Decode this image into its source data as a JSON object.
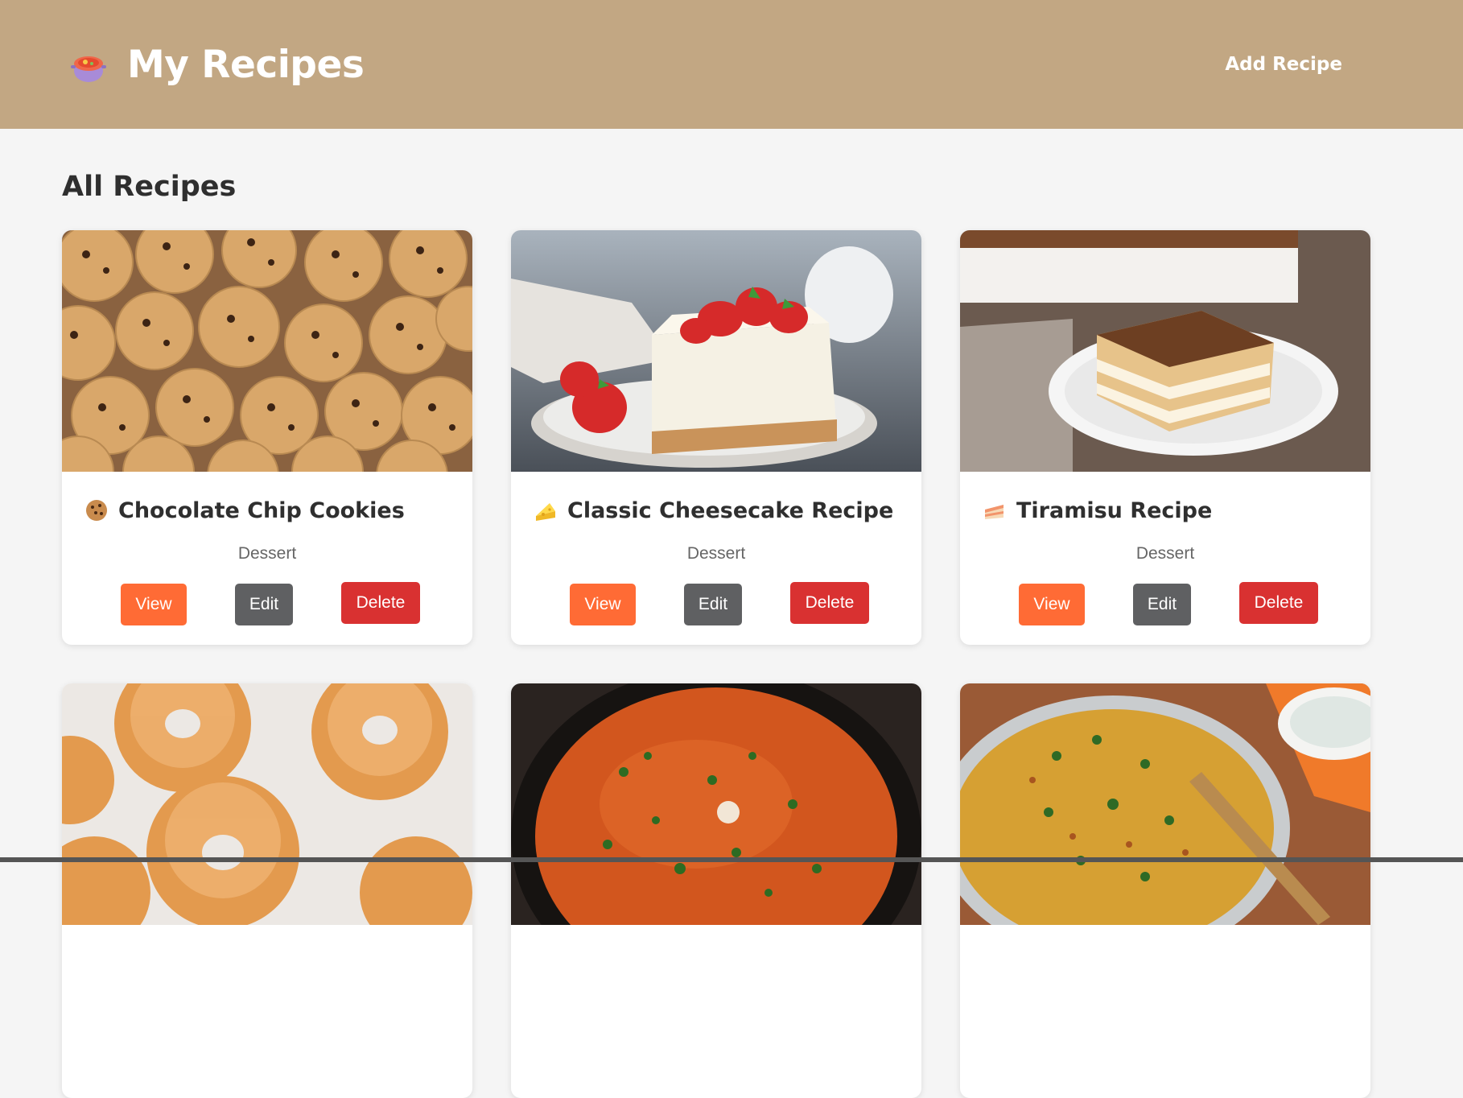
{
  "header": {
    "title": "My Recipes",
    "logo_icon": "soup-pot-icon",
    "add_link": "Add Recipe",
    "background": "#c2a783"
  },
  "main": {
    "section_title": "All Recipes"
  },
  "recipes": [
    {
      "title": "Chocolate Chip Cookies",
      "category": "Dessert",
      "icon": "cookie-icon",
      "image": "cookies-photo"
    },
    {
      "title": "Classic Cheesecake Recipe",
      "category": "Dessert",
      "icon": "cheese-icon",
      "image": "cheesecake-photo"
    },
    {
      "title": "Tiramisu Recipe",
      "category": "Dessert",
      "icon": "cake-slice-icon",
      "image": "tiramisu-photo"
    },
    {
      "image": "donuts-photo"
    },
    {
      "image": "curry-photo"
    },
    {
      "image": "biryani-photo"
    }
  ],
  "buttons": {
    "view": "View",
    "edit": "Edit",
    "delete": "Delete"
  },
  "colors": {
    "view": "#ff6b35",
    "edit": "#5f6062",
    "delete": "#d93131"
  }
}
